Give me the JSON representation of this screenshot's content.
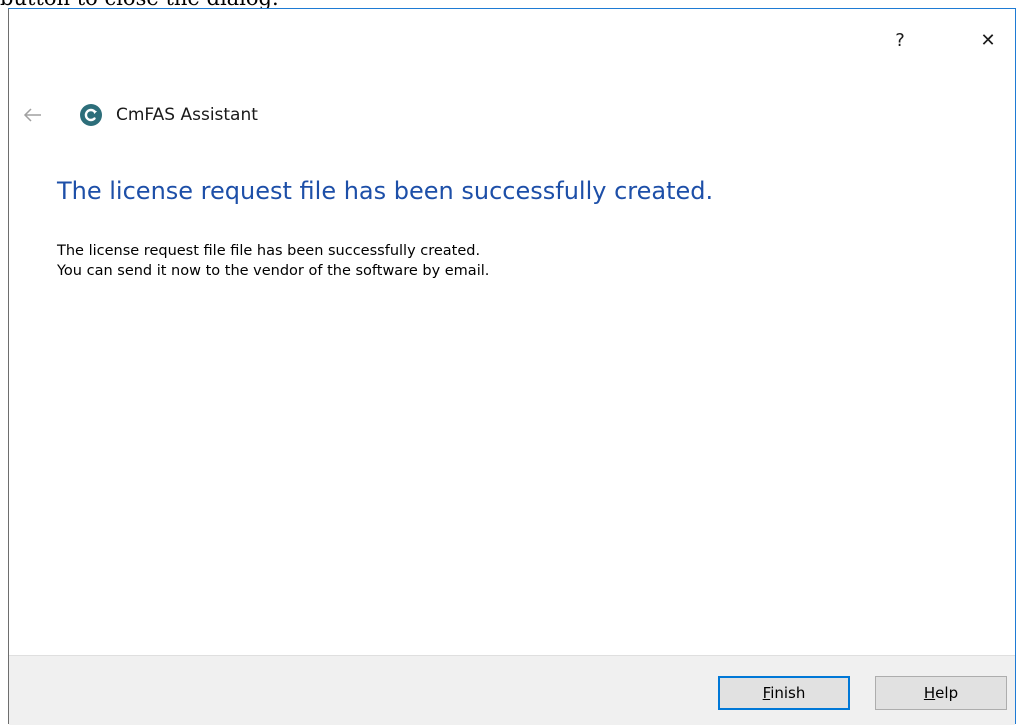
{
  "background_text": "button to close the dialog.",
  "titlebar": {
    "help_glyph": "?",
    "close_glyph": "✕"
  },
  "header": {
    "back_icon": "back-arrow-icon",
    "app_icon": "cmfas-app-icon",
    "app_name": "CmFAS Assistant"
  },
  "content": {
    "heading": "The license request file has been successfully created.",
    "lines": [
      "The license request file file has been successfully created.",
      "You can send it now to the vendor of the software by email."
    ]
  },
  "footer": {
    "finish_label": "Finish",
    "help_label": "Help"
  },
  "colors": {
    "heading": "#1d4fa8",
    "accent": "#0078d7",
    "footer_bg": "#f0f0f0"
  }
}
